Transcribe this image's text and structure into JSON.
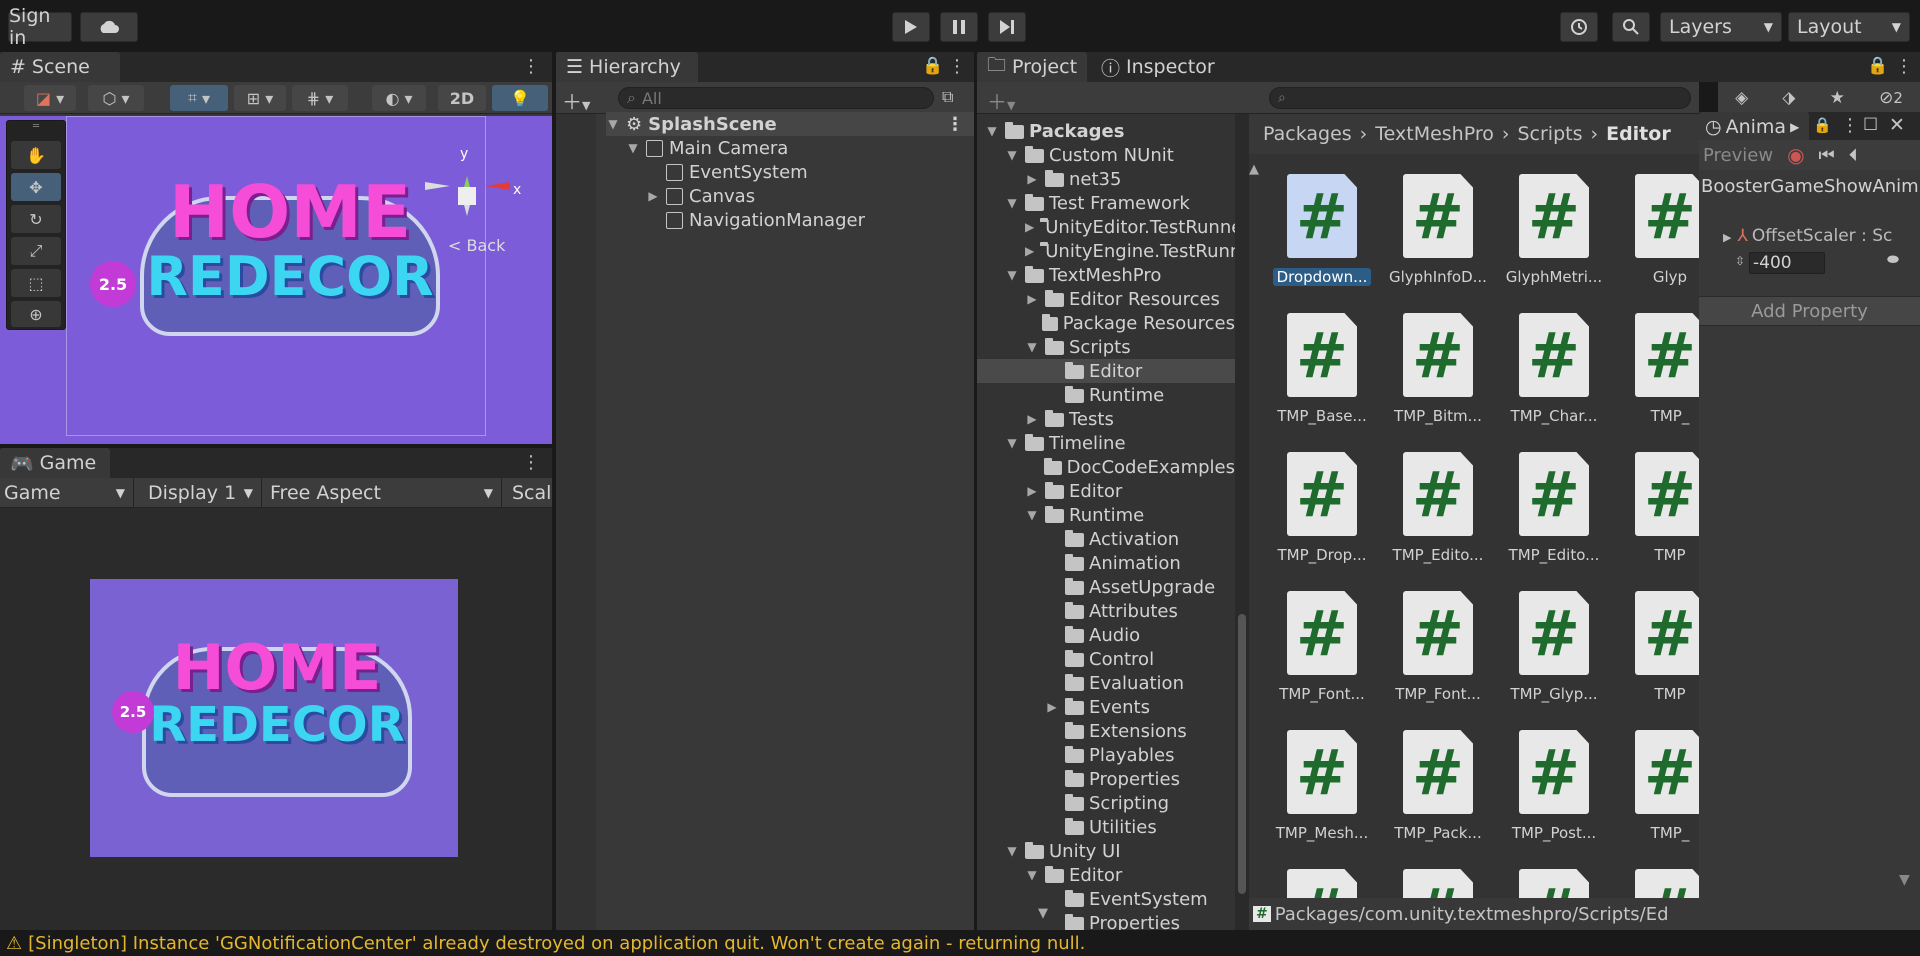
{
  "topbar": {
    "signin": "Sign in",
    "layers": "Layers",
    "layout": "Layout"
  },
  "scene": {
    "tab": "Scene",
    "mode_2d": "2D",
    "gizmo_back": "< Back",
    "axis_x": "x",
    "axis_y": "y"
  },
  "game": {
    "tab": "Game",
    "view_select": "Game",
    "display_select": "Display 1",
    "aspect_select": "Free Aspect",
    "scale_label": "Scal",
    "logo_line1": "HOME",
    "logo_line2": "REDECOR",
    "logo_badge": "2.5"
  },
  "hierarchy": {
    "tab": "Hierarchy",
    "search_placeholder": "All",
    "items": [
      {
        "label": "SplashScene",
        "depth": 0
      },
      {
        "label": "Main Camera",
        "depth": 1
      },
      {
        "label": "EventSystem",
        "depth": 2
      },
      {
        "label": "Canvas",
        "depth": 2
      },
      {
        "label": "NavigationManager",
        "depth": 2
      }
    ]
  },
  "project": {
    "tab": "Project",
    "inspector_tab": "Inspector",
    "hidden_count": "2",
    "tree": [
      {
        "label": "Packages",
        "depth": 0,
        "open": true
      },
      {
        "label": "Custom NUnit",
        "depth": 1,
        "open": true
      },
      {
        "label": "net35",
        "depth": 2,
        "open": false
      },
      {
        "label": "Test Framework",
        "depth": 1,
        "open": true
      },
      {
        "label": "UnityEditor.TestRunne",
        "depth": 2,
        "open": false
      },
      {
        "label": "UnityEngine.TestRunn",
        "depth": 2,
        "open": false
      },
      {
        "label": "TextMeshPro",
        "depth": 1,
        "open": true
      },
      {
        "label": "Editor Resources",
        "depth": 2,
        "open": false
      },
      {
        "label": "Package Resources",
        "depth": 2,
        "open": null
      },
      {
        "label": "Scripts",
        "depth": 2,
        "open": true
      },
      {
        "label": "Editor",
        "depth": 3,
        "open": null,
        "selected": true
      },
      {
        "label": "Runtime",
        "depth": 3,
        "open": null
      },
      {
        "label": "Tests",
        "depth": 2,
        "open": false
      },
      {
        "label": "Timeline",
        "depth": 1,
        "open": true
      },
      {
        "label": "DocCodeExamples",
        "depth": 2,
        "open": null
      },
      {
        "label": "Editor",
        "depth": 2,
        "open": false
      },
      {
        "label": "Runtime",
        "depth": 2,
        "open": true
      },
      {
        "label": "Activation",
        "depth": 3,
        "open": null
      },
      {
        "label": "Animation",
        "depth": 3,
        "open": null
      },
      {
        "label": "AssetUpgrade",
        "depth": 3,
        "open": null
      },
      {
        "label": "Attributes",
        "depth": 3,
        "open": null
      },
      {
        "label": "Audio",
        "depth": 3,
        "open": null
      },
      {
        "label": "Control",
        "depth": 3,
        "open": null
      },
      {
        "label": "Evaluation",
        "depth": 3,
        "open": null
      },
      {
        "label": "Events",
        "depth": 3,
        "open": false
      },
      {
        "label": "Extensions",
        "depth": 3,
        "open": null
      },
      {
        "label": "Playables",
        "depth": 3,
        "open": null
      },
      {
        "label": "Properties",
        "depth": 3,
        "open": null
      },
      {
        "label": "Scripting",
        "depth": 3,
        "open": null
      },
      {
        "label": "Utilities",
        "depth": 3,
        "open": null
      },
      {
        "label": "Unity UI",
        "depth": 1,
        "open": true
      },
      {
        "label": "Editor",
        "depth": 2,
        "open": true
      },
      {
        "label": "EventSystem",
        "depth": 3,
        "open": null
      },
      {
        "label": "Properties",
        "depth": 3,
        "open": null
      }
    ],
    "breadcrumb": [
      "Packages",
      "TextMeshPro",
      "Scripts",
      "Editor"
    ],
    "assets": [
      [
        "Dropdown...",
        "GlyphInfoD...",
        "GlyphMetri...",
        "Glyp"
      ],
      [
        "TMP_Base...",
        "TMP_Bitm...",
        "TMP_Char...",
        "TMP_"
      ],
      [
        "TMP_Drop...",
        "TMP_Edito...",
        "TMP_Edito...",
        "TMP"
      ],
      [
        "TMP_Font...",
        "TMP_Font...",
        "TMP_Glyp...",
        "TMP"
      ],
      [
        "TMP_Mesh...",
        "TMP_Pack...",
        "TMP_Post...",
        "TMP_"
      ]
    ],
    "path": "Packages/com.unity.textmeshpro/Scripts/Ed"
  },
  "animation": {
    "tab": "Anima",
    "preview": "Preview",
    "clip": "BoosterGameShowAnim",
    "property": "OffsetScaler : Sc",
    "value": "-400",
    "add_property": "Add Property"
  },
  "status": {
    "message": "[Singleton] Instance 'GGNotificationCenter' already destroyed on application quit. Won't create again - returning null."
  }
}
